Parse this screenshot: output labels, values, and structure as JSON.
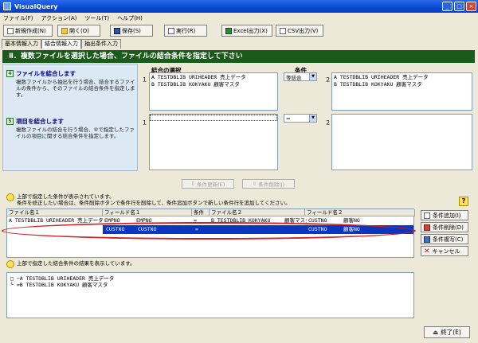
{
  "window": {
    "title": "VisualQuery"
  },
  "menu": [
    "ファイル(F)",
    "アクション(A)",
    "ツール(T)",
    "ヘルプ(H)"
  ],
  "toolbar": {
    "new": "新規作成(N)",
    "open": "開く(O)",
    "save": "保存(S)",
    "run": "実行(R)",
    "excel": "Excel出力(X)",
    "csv": "CSV出力(V)"
  },
  "tabs": [
    "基本情報入力",
    "結合情報入力",
    "抽出条件入力"
  ],
  "heading": "Ⅱ．複数ファイルを選択した場合、ファイルの結合条件を指定して下さい",
  "left": {
    "sec1_num": "4",
    "sec1_title": "ファイルを結合します",
    "sec1_desc": "複数ファイルから抽出を行う場合、結合するファイルの条件から、そのファイルの結合条件を指定します。",
    "sec2_num": "5",
    "sec2_title": "項目を結合します",
    "sec2_desc": "複数ファイルの結合を行う場合、④で指定したファイルの項目に関する結合条件を指定します。"
  },
  "join": {
    "file1_label": "ファイル名１",
    "field1_label": "フィールド名１",
    "file2_label": "ファイル名２",
    "field2_label": "フィールド名２",
    "selection_title": "結合の選択",
    "condition_title": "条件",
    "condition_value": "等結合",
    "field_condition": "=",
    "left_files": [
      "A   TESTDBLIB  URIHEADER  売上データ",
      "B   TESTDBLIB  KOKYAKU    顧客マスタ"
    ],
    "right_files": [
      "A   TESTDBLIB  URIHEADER  売上データ",
      "B   TESTDBLIB  KOKYAKU    顧客マスタ"
    ],
    "update_btn": "条件更新(E)",
    "delete_btn": "条件削除(J)"
  },
  "grid_info": {
    "line1": "上部で指定した条件が表示されています。",
    "line2": "条件を修正したい場合は、条件削除ボタンで条件行を削除して、条件追加ボタンで新しい条件行を追加してください。"
  },
  "grid": {
    "headers": [
      "ファイル名１",
      "フィールド名１",
      "条件",
      "ファイル名２",
      "フィールド名２"
    ],
    "row1": [
      "A    TESTDBLIB  URIHEADER  売上データ",
      "EMPNO",
      "EMPNO",
      "=",
      "B    TESTDBLIB  KOKYAKU",
      "顧客マスタ",
      "CUSTNO",
      "顧客NO"
    ],
    "row2": [
      "CUSTNO",
      "CUSTNO",
      "=",
      "CUSTNO",
      "顧客NO"
    ]
  },
  "side_buttons": {
    "add": "条件追加(I)",
    "remove": "条件削除(D)",
    "copy": "条件複写(C)",
    "cancel": "キャンセル"
  },
  "tree_info": "上部で指定した結合条件の結果を表示しています。",
  "tree": [
    "□ −A   TESTDBLIB  URIHEADER  売上データ",
    "   └ =B   TESTDBLIB  KOKYAKU   顧客マスタ"
  ],
  "help": "?",
  "exit": "終了(E)",
  "colors": {
    "title": "#0a4ad2",
    "heading": "#1a5a1a",
    "selection": "#0a36c0",
    "annotation": "#d02020"
  }
}
